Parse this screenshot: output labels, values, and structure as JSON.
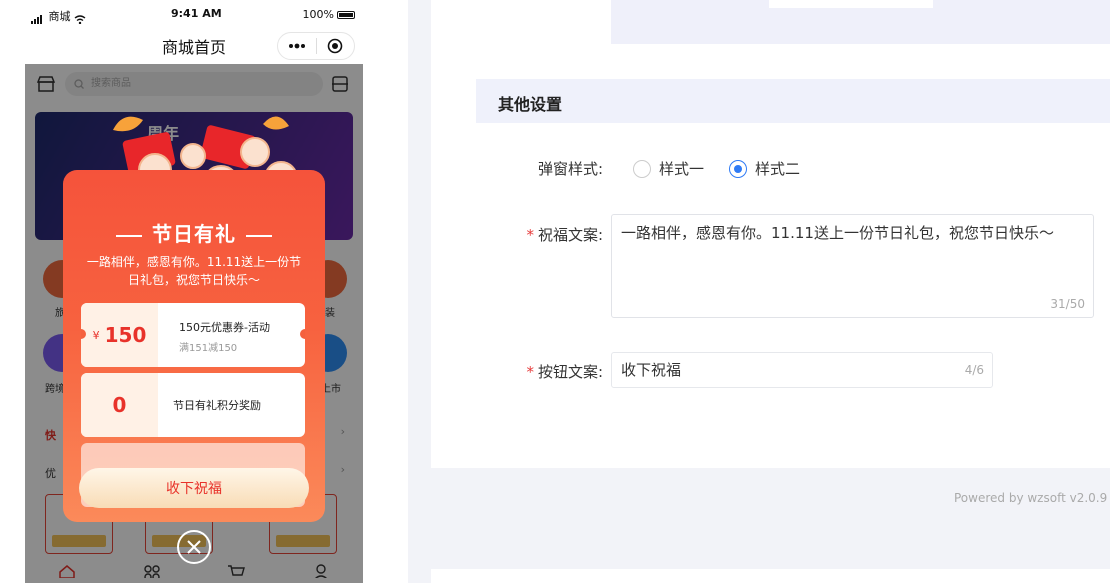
{
  "phone": {
    "status": {
      "carrier": "商城",
      "time": "9:41 AM",
      "battery": "100%"
    },
    "nav_title": "商城首页",
    "search_placeholder": "搜索商品",
    "banner_text": "周年",
    "section_labels": [
      "快",
      "优"
    ],
    "icon_labels_left": [
      "旅",
      "跨境"
    ],
    "icon_labels_right": [
      "装",
      "上市"
    ]
  },
  "popup": {
    "title": "节日有礼",
    "message": "一路相伴，感恩有你。11.11送上一份节日礼包，祝您节日快乐～",
    "cards": [
      {
        "currency": "¥",
        "amount": "150",
        "name": "150元优惠券-活动",
        "sub": "满151减150"
      },
      {
        "currency": "",
        "amount": "0",
        "name": "节日有礼积分奖励",
        "sub": ""
      }
    ],
    "accept_button": "收下祝福"
  },
  "settings": {
    "section_title": "其他设置",
    "popup_style_label": "弹窗样式:",
    "style_options": [
      "样式一",
      "样式二"
    ],
    "selected_style_index": 1,
    "blessing_label": "祝福文案:",
    "blessing_text": "一路相伴，感恩有你。11.11送上一份节日礼包，祝您节日快乐～",
    "blessing_count": "31/50",
    "button_label": "按钮文案:",
    "button_text": "收下祝福",
    "button_count": "4/6",
    "footer": "Powered by wzsoft v2.0.9"
  },
  "colors": {
    "accent_blue": "#2f7bf5",
    "popup_red": "#f5533b",
    "required_red": "#e63c3c"
  }
}
